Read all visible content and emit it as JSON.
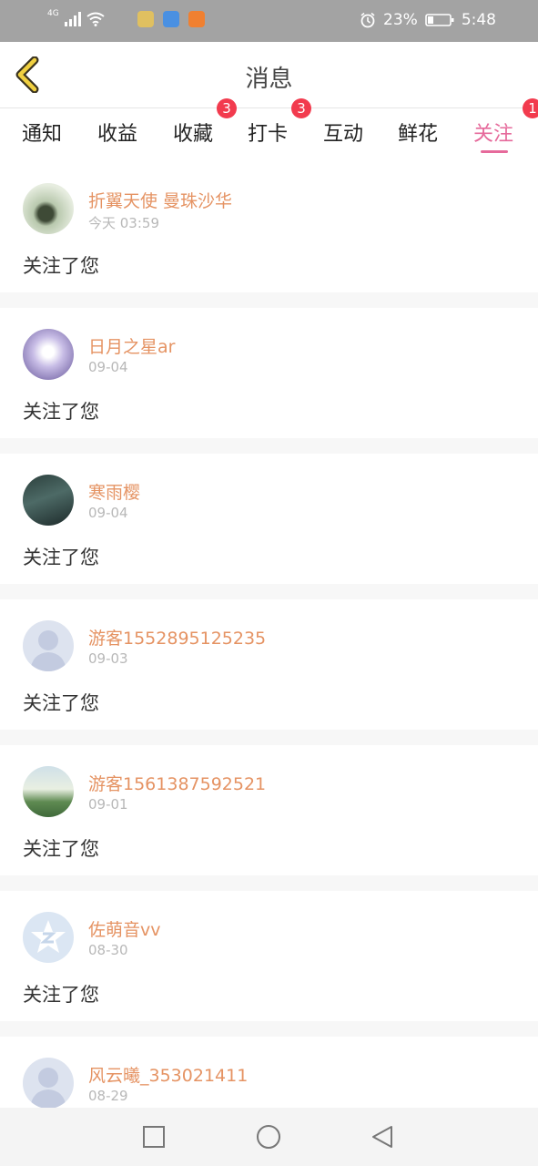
{
  "status_bar": {
    "network": "4G",
    "battery": "23%",
    "time": "5:48"
  },
  "header": {
    "title": "消息"
  },
  "tabs": [
    {
      "label": "通知",
      "badge": ""
    },
    {
      "label": "收益",
      "badge": ""
    },
    {
      "label": "收藏",
      "badge": "3"
    },
    {
      "label": "打卡",
      "badge": "3"
    },
    {
      "label": "互动",
      "badge": ""
    },
    {
      "label": "鲜花",
      "badge": ""
    },
    {
      "label": "关注",
      "badge": "1"
    }
  ],
  "items": [
    {
      "name": "折翼天使 曼珠沙华",
      "time": "今天 03:59",
      "message": "关注了您"
    },
    {
      "name": "日月之星ar",
      "time": "09-04",
      "message": "关注了您"
    },
    {
      "name": "寒雨樱",
      "time": "09-04",
      "message": "关注了您"
    },
    {
      "name": "游客1552895125235",
      "time": "09-03",
      "message": "关注了您"
    },
    {
      "name": "游客1561387592521",
      "time": "09-01",
      "message": "关注了您"
    },
    {
      "name": "佐萌音vv",
      "time": "08-30",
      "message": "关注了您"
    },
    {
      "name": "风云曦_353021411",
      "time": "08-29",
      "message": ""
    }
  ],
  "colors": {
    "accent": "#e66a9b",
    "name": "#e59363",
    "badge": "#f23b4e",
    "statusbar": "#a3a3a3"
  }
}
